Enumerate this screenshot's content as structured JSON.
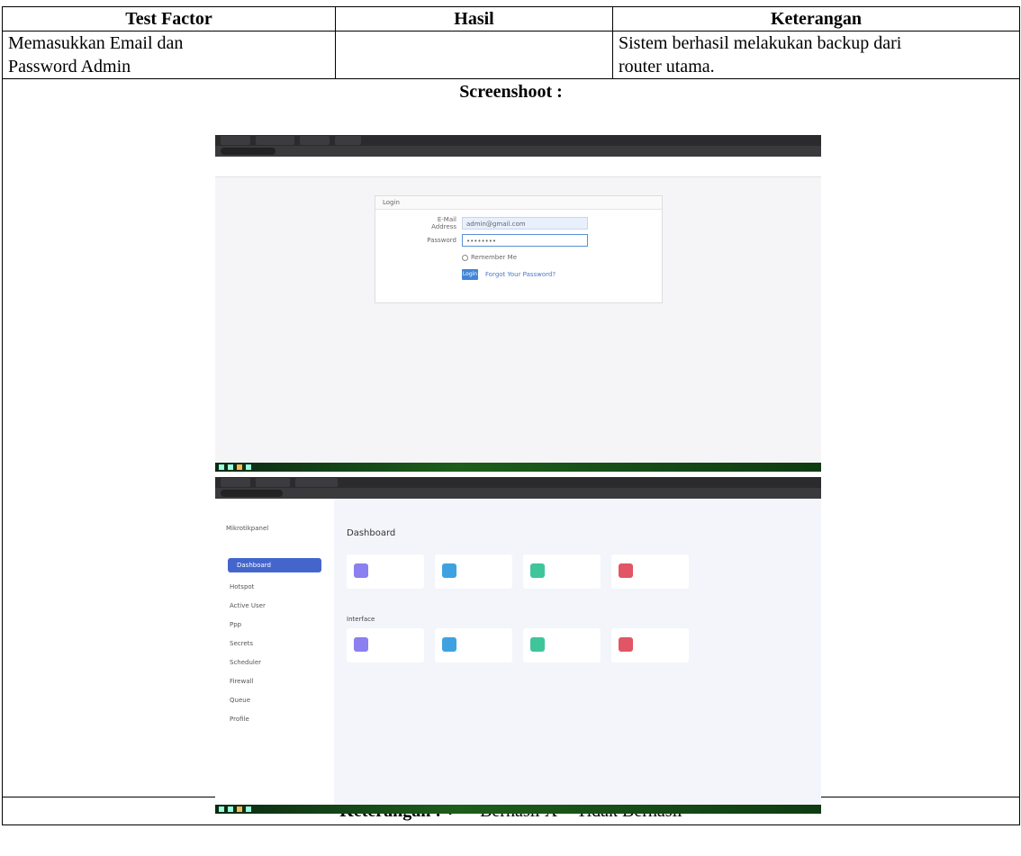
{
  "table": {
    "headers": [
      "Test Factor",
      "Hasil",
      "Keterangan"
    ],
    "row": {
      "test_factor_line1": "Memasukkan Email dan",
      "test_factor_line2": "Password Admin",
      "hasil": "",
      "keterangan_line1": "Sistem berhasil melakukan backup dari",
      "keterangan_line2": "router utama."
    },
    "screenshot_label": "Screenshoot :",
    "footer": {
      "label": "Keterangan :",
      "check_symbol": "✓",
      "legend": "= Berhasil X = Tidak Berhasil"
    }
  },
  "screenshot1": {
    "tabs": [
      "",
      "",
      "",
      ""
    ],
    "login_header": "Login",
    "email_label": "E-Mail Address",
    "email_value": "admin@gmail.com",
    "password_label": "Password",
    "password_value": "••••••••",
    "remember_label": "Remember Me",
    "login_button": "Login",
    "forgot_link": "Forgot Your Password?"
  },
  "screenshot2": {
    "brand": "Mikrotikpanel",
    "menu_active": "Dashboard",
    "menu_items": [
      "Hotspot",
      "Active User",
      "Ppp",
      "Secrets",
      "Scheduler",
      "Firewall",
      "Queue",
      "Profile"
    ],
    "page_title": "Dashboard",
    "section_label": "Interface"
  },
  "colors": {
    "accent_blue": "#4466cc",
    "stat_purple": "#8c7ff0",
    "stat_blue": "#3fa2e0",
    "stat_green": "#3fc59a",
    "stat_red": "#e25564"
  }
}
